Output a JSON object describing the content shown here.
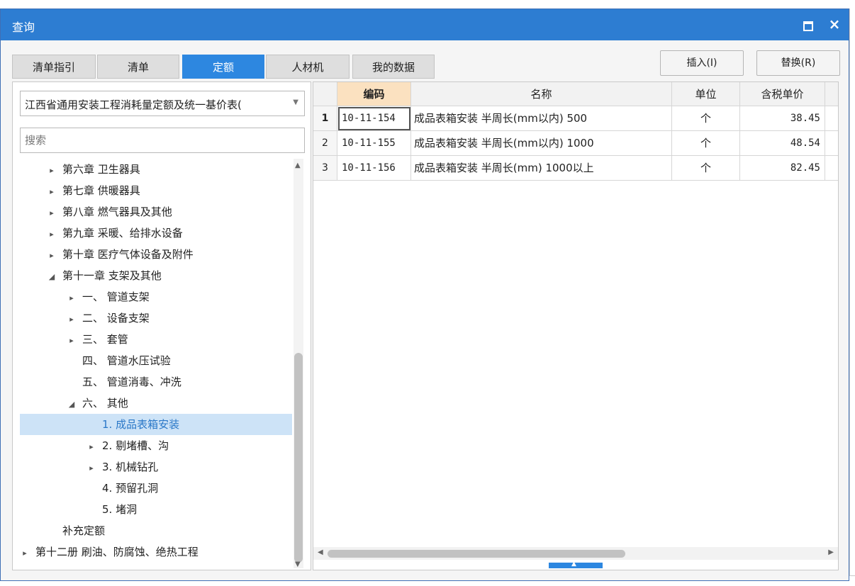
{
  "window": {
    "title": "查询"
  },
  "tabs": [
    {
      "label": "清单指引",
      "active": false
    },
    {
      "label": "清单",
      "active": false
    },
    {
      "label": "定额",
      "active": true
    },
    {
      "label": "人材机",
      "active": false
    },
    {
      "label": "我的数据",
      "active": false
    }
  ],
  "actions": {
    "insert_label": "插入(I)",
    "replace_label": "替换(R)"
  },
  "library": {
    "selected": "江西省通用安装工程消耗量定额及统一基价表("
  },
  "search": {
    "placeholder": "搜索"
  },
  "tree": [
    {
      "label": "第六章 卫生器具",
      "toggle": "▸",
      "selected": false
    },
    {
      "label": "第七章 供暖器具",
      "toggle": "▸",
      "selected": false
    },
    {
      "label": "第八章 燃气器具及其他",
      "toggle": "▸",
      "selected": false
    },
    {
      "label": "第九章 采暖、给排水设备",
      "toggle": "▸",
      "selected": false
    },
    {
      "label": "第十章 医疗气体设备及附件",
      "toggle": "▸",
      "selected": false
    },
    {
      "label": "第十一章 支架及其他",
      "toggle": "◢",
      "selected": false
    },
    {
      "label": "一、 管道支架",
      "toggle": "▸",
      "selected": false
    },
    {
      "label": "二、 设备支架",
      "toggle": "▸",
      "selected": false
    },
    {
      "label": "三、 套管",
      "toggle": "▸",
      "selected": false
    },
    {
      "label": "四、 管道水压试验",
      "toggle": "",
      "selected": false
    },
    {
      "label": "五、 管道消毒、冲洗",
      "toggle": "",
      "selected": false
    },
    {
      "label": "六、 其他",
      "toggle": "◢",
      "selected": false
    },
    {
      "label": "1. 成品表箱安装",
      "toggle": "",
      "selected": true
    },
    {
      "label": "2. 剔堵槽、沟",
      "toggle": "▸",
      "selected": false
    },
    {
      "label": "3. 机械钻孔",
      "toggle": "▸",
      "selected": false
    },
    {
      "label": "4. 预留孔洞",
      "toggle": "",
      "selected": false
    },
    {
      "label": "5. 堵洞",
      "toggle": "",
      "selected": false
    },
    {
      "label": "补充定额",
      "toggle": "",
      "selected": false
    },
    {
      "label": "第十二册 刷油、防腐蚀、绝热工程",
      "toggle": "▸",
      "selected": false
    }
  ],
  "table": {
    "columns": [
      "编码",
      "名称",
      "单位",
      "含税单价"
    ],
    "rows": [
      {
        "num": "1",
        "code": "10-11-154",
        "name": "成品表箱安装 半周长(mm以内) 500",
        "unit": "个",
        "price": "38.45"
      },
      {
        "num": "2",
        "code": "10-11-155",
        "name": "成品表箱安装 半周长(mm以内) 1000",
        "unit": "个",
        "price": "48.54"
      },
      {
        "num": "3",
        "code": "10-11-156",
        "name": "成品表箱安装 半周长(mm) 1000以上",
        "unit": "个",
        "price": "82.45"
      }
    ]
  },
  "colors": {
    "titlebar": "#2d7dd2",
    "active_tab": "#2d87e0",
    "selected_node": "#cde3f7",
    "key_header": "#fbe1c0"
  }
}
